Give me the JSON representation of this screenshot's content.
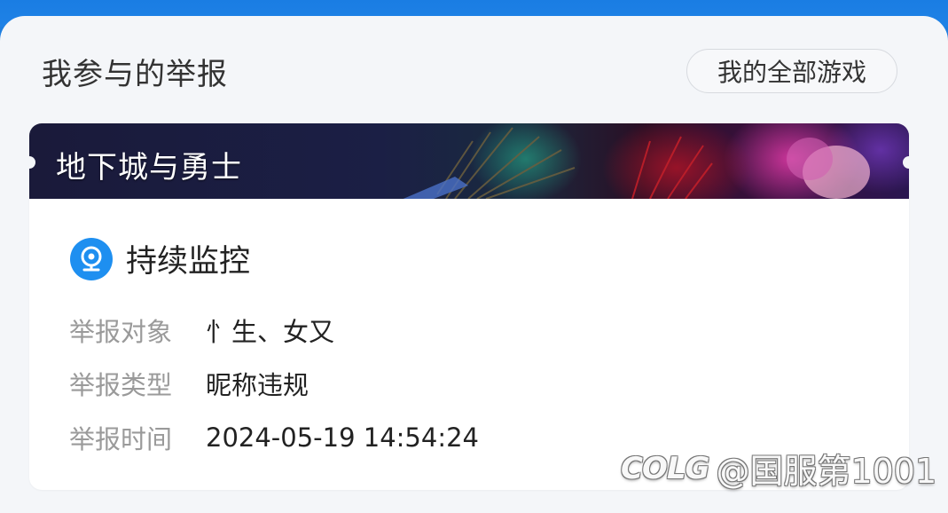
{
  "header": {
    "title": "我参与的举报",
    "all_games_button": "我的全部游戏"
  },
  "card": {
    "game_name": "地下城与勇士",
    "status": {
      "icon": "monitor-camera-icon",
      "label": "持续监控",
      "icon_color": "#1e8ff0"
    },
    "fields": [
      {
        "label": "举报对象",
        "value": "忄生、女又"
      },
      {
        "label": "举报类型",
        "value": "昵称违规"
      },
      {
        "label": "举报时间",
        "value": "2024-05-19 14:54:24"
      }
    ]
  },
  "watermark": {
    "logo": "COLG",
    "text": "@国服第1001"
  },
  "colors": {
    "top_bar": "#1f7fe0",
    "background": "#f4f6f9",
    "card": "#ffffff",
    "accent": "#1e8ff0"
  }
}
